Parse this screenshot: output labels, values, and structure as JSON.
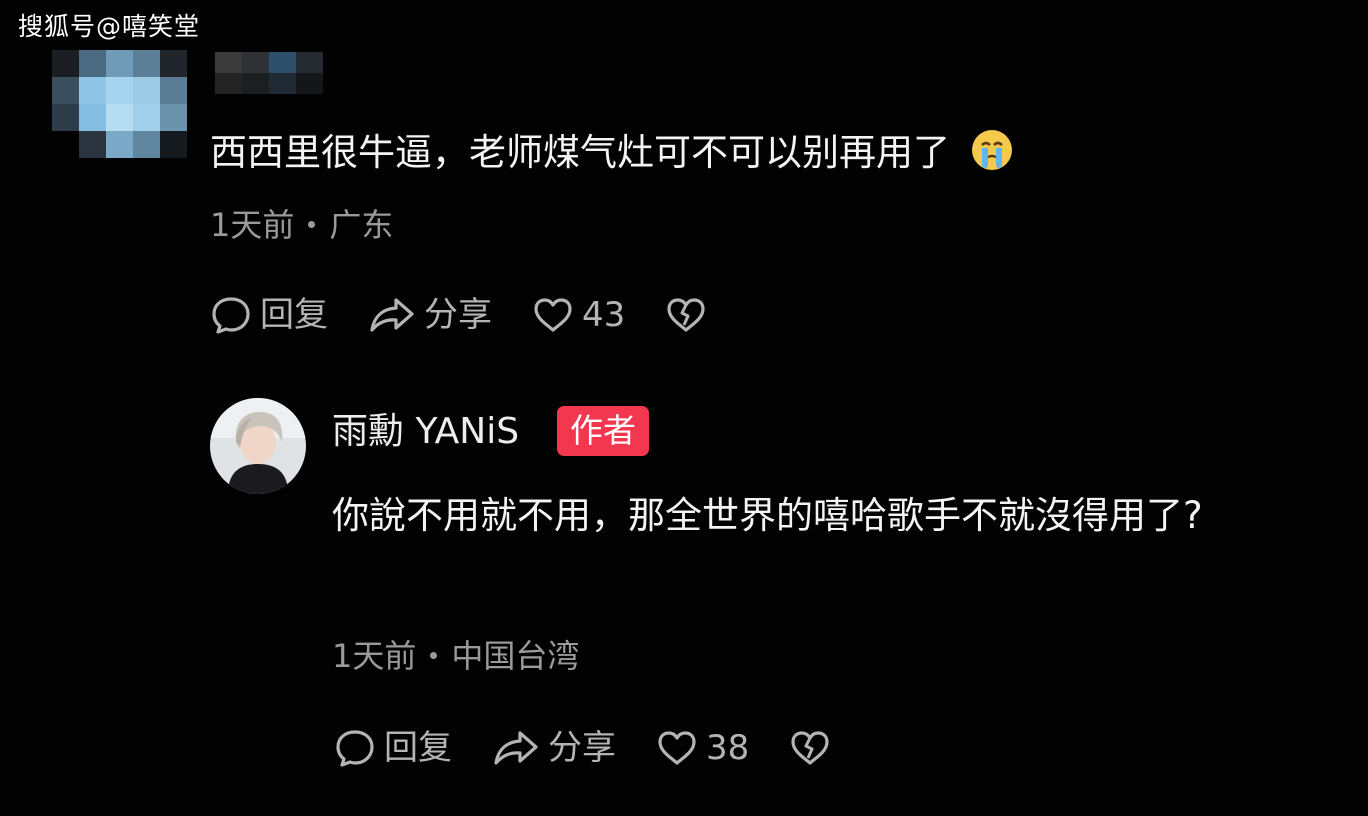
{
  "watermark": "搜狐号@嘻笑堂",
  "comment": {
    "text": "西西里很牛逼，老师煤气灶可不可以别再用了",
    "emoji": "crying-face",
    "time": "1天前",
    "location": "广东",
    "reply_label": "回复",
    "share_label": "分享",
    "likes": "43"
  },
  "reply": {
    "author": "雨勳 YANiS",
    "badge": "作者",
    "text": "你說不用就不用，那全世界的嘻哈歌手不就沒得用了?",
    "time": "1天前",
    "location": "中国台湾",
    "reply_label": "回复",
    "share_label": "分享",
    "likes": "38"
  },
  "colors": {
    "background": "#020202",
    "badge": "#f2374f",
    "meta_text": "#9a9a9a",
    "action_text": "#b4b4b4"
  },
  "icons": [
    "comment-bubble-icon",
    "share-arrow-icon",
    "heart-icon",
    "broken-heart-icon",
    "crying-face-emoji"
  ]
}
